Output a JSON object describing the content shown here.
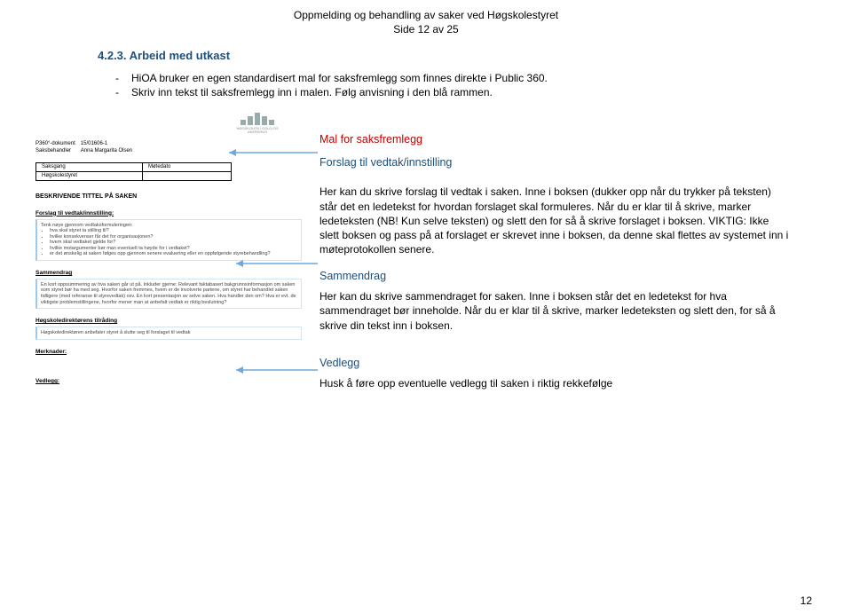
{
  "header": {
    "line1": "Oppmelding og behandling av saker ved Høgskolestyret",
    "line2": "Side 12 av 25"
  },
  "section": {
    "number_title": "4.2.3. Arbeid med utkast",
    "bullets": [
      "HiOA bruker en egen standardisert mal for saksfremlegg som finnes direkte i Public 360.",
      "Skriv inn tekst til saksfremlegg inn i malen. Følg anvisning i den blå rammen."
    ]
  },
  "form": {
    "logo_text": "HØGSKOLEN I OSLO OG AKERSHUS",
    "doc_label": "P360°-dokument",
    "doc_value": "15/01606-1",
    "handler_label": "Saksbehandler",
    "handler_value": "Anna Margarita Olsen",
    "gang_hdr1": "Saksgang",
    "gang_hdr2": "Møtedato",
    "gang_row": "Høgskolestyret",
    "title_heading": "BESKRIVENDE TITTEL PÅ SAKEN",
    "forslag_heading": "Forslag til vedtak/innstilling:",
    "forslag_intro": "Tenk nøye gjennom vedtaksformuleringen:",
    "forslag_items": [
      "hva skal styret ta stilling til?",
      "hvilke konsekvenser får det for organisasjonen?",
      "hvem skal vedtaket gjelde for?",
      "hvilke motargumenter bør man eventuelt ta høyde for i vedtaket?",
      "er det ønskelig at saken følges opp gjennom senere evaluering eller en oppfølgende styrebehandling?"
    ],
    "sammendrag_heading": "Sammendrag",
    "sammendrag_box": "En kort oppsummering av hva saken går ut på. Inkluder gjerne: Relevant faktabasert bakgrunnsinformasjon om saken som styret bør ha med seg. Hvorfor saken fremmes, hvem er de involverte partene, om styret har behandlet saken tidligere (med referanse til styrevedtak) osv. En kort presentasjon av selve saken. Hva handler den om? Hva er evt. de viktigste problemstillingene, hvorfor mener man at anbefalt vedtak er riktig beslutning?",
    "tilraading_heading": "Høgskoledirektørens tilråding",
    "tilraading_box": "Høgskoledirektøren anbefaler styret å slutte seg til forslaget til vedtak",
    "merknader_heading": "Merknader:",
    "vedlegg_heading": "Vedlegg:"
  },
  "annotations": {
    "red": "Mal for saksfremlegg",
    "blue1": "Forslag til vedtak/innstilling",
    "text1": "Her kan du skrive forslag til vedtak i saken. Inne i boksen (dukker opp når du trykker på teksten) står det en ledetekst for hvordan forslaget skal formuleres. Når du er klar til å skrive, marker ledeteksten (NB! Kun selve teksten) og slett den for så å skrive forslaget i boksen. VIKTIG: Ikke slett boksen og pass på at forslaget er skrevet inne i boksen, da denne skal flettes av systemet  inn i møteprotokollen senere.",
    "blue2": "Sammendrag",
    "text2": "Her kan du skrive sammendraget for saken. Inne i boksen står det en ledetekst for hva sammendraget bør inneholde. Når du er klar til å skrive, marker ledeteksten og slett den, for så å skrive din tekst inn i boksen.",
    "blue3": "Vedlegg",
    "text3": "Husk å føre opp eventuelle vedlegg til saken i riktig rekkefølge"
  },
  "page_number": "12"
}
